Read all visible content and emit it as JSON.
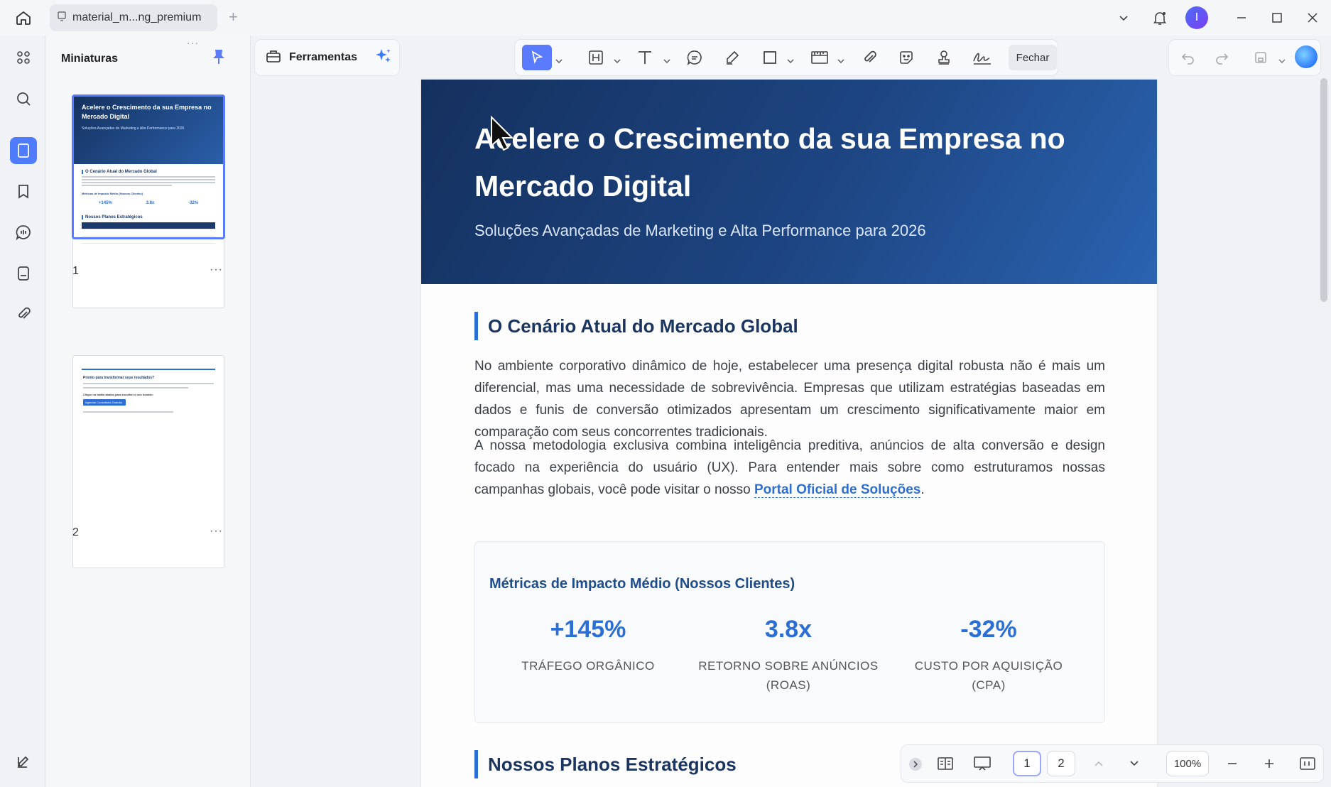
{
  "window": {
    "tab_title": "material_m...ng_premium",
    "avatar_initial": "I"
  },
  "thumbnails": {
    "title": "Miniaturas",
    "pages": [
      {
        "number": "1",
        "more": "···"
      },
      {
        "number": "2",
        "more": "···"
      }
    ]
  },
  "toolbar": {
    "tools_label": "Ferramentas",
    "close_label": "Fechar"
  },
  "document": {
    "banner_title": "Acelere o Crescimento da sua Empresa no Mercado Digital",
    "banner_subtitle": "Soluções Avançadas de Marketing e Alta Performance para 2026",
    "section1_title": "O Cenário Atual do Mercado Global",
    "para1": "No ambiente corporativo dinâmico de hoje, estabelecer uma presença digital robusta não é mais um diferencial, mas uma necessidade de sobrevivência. Empresas que utilizam estratégias baseadas em dados e funis de conversão otimizados apresentam um crescimento significativamente maior em comparação com seus concorrentes tradicionais.",
    "para2_text": "A nossa metodologia exclusiva combina inteligência preditiva, anúncios de alta conversão e design focado na experiência do usuário (UX). Para entender mais sobre como estruturamos nossas campanhas globais, você pode visitar o nosso ",
    "para2_link": "Portal Oficial de Soluções",
    "para2_end": ".",
    "metrics_title": "Métricas de Impacto Médio (Nossos Clientes)",
    "metrics": [
      {
        "value": "+145%",
        "label": "TRÁFEGO ORGÂNICO"
      },
      {
        "value": "3.8x",
        "label": "RETORNO SOBRE ANÚNCIOS (ROAS)"
      },
      {
        "value": "-32%",
        "label": "CUSTO POR AQUISIÇÃO (CPA)"
      }
    ],
    "section2_title": "Nossos Planos Estratégicos"
  },
  "thumb_content": {
    "title": "Acelere o Crescimento da sua Empresa no Mercado Digital",
    "subtitle": "Soluções Avançadas de Marketing e Alta Performance para 2026",
    "h1": "O Cenário Atual do Mercado Global",
    "metrics_title": "Métricas de Impacto Médio (Nossos Clientes)",
    "m1": "+145%",
    "m2": "3.8x",
    "m3": "-32%",
    "h2": "Nossos Planos Estratégicos",
    "p2_title": "Pronto para transformar seus resultados?",
    "p2_cta_title": "Clique no botão abaixo para escolher o seu horário:",
    "p2_button": "Agendar Consultoria Gratuita"
  },
  "bottom_nav": {
    "page_1": "1",
    "page_2": "2",
    "zoom": "100%"
  },
  "colors": {
    "accent": "#5b7bff",
    "banner": "#1d4582",
    "link": "#2b6fd6"
  }
}
